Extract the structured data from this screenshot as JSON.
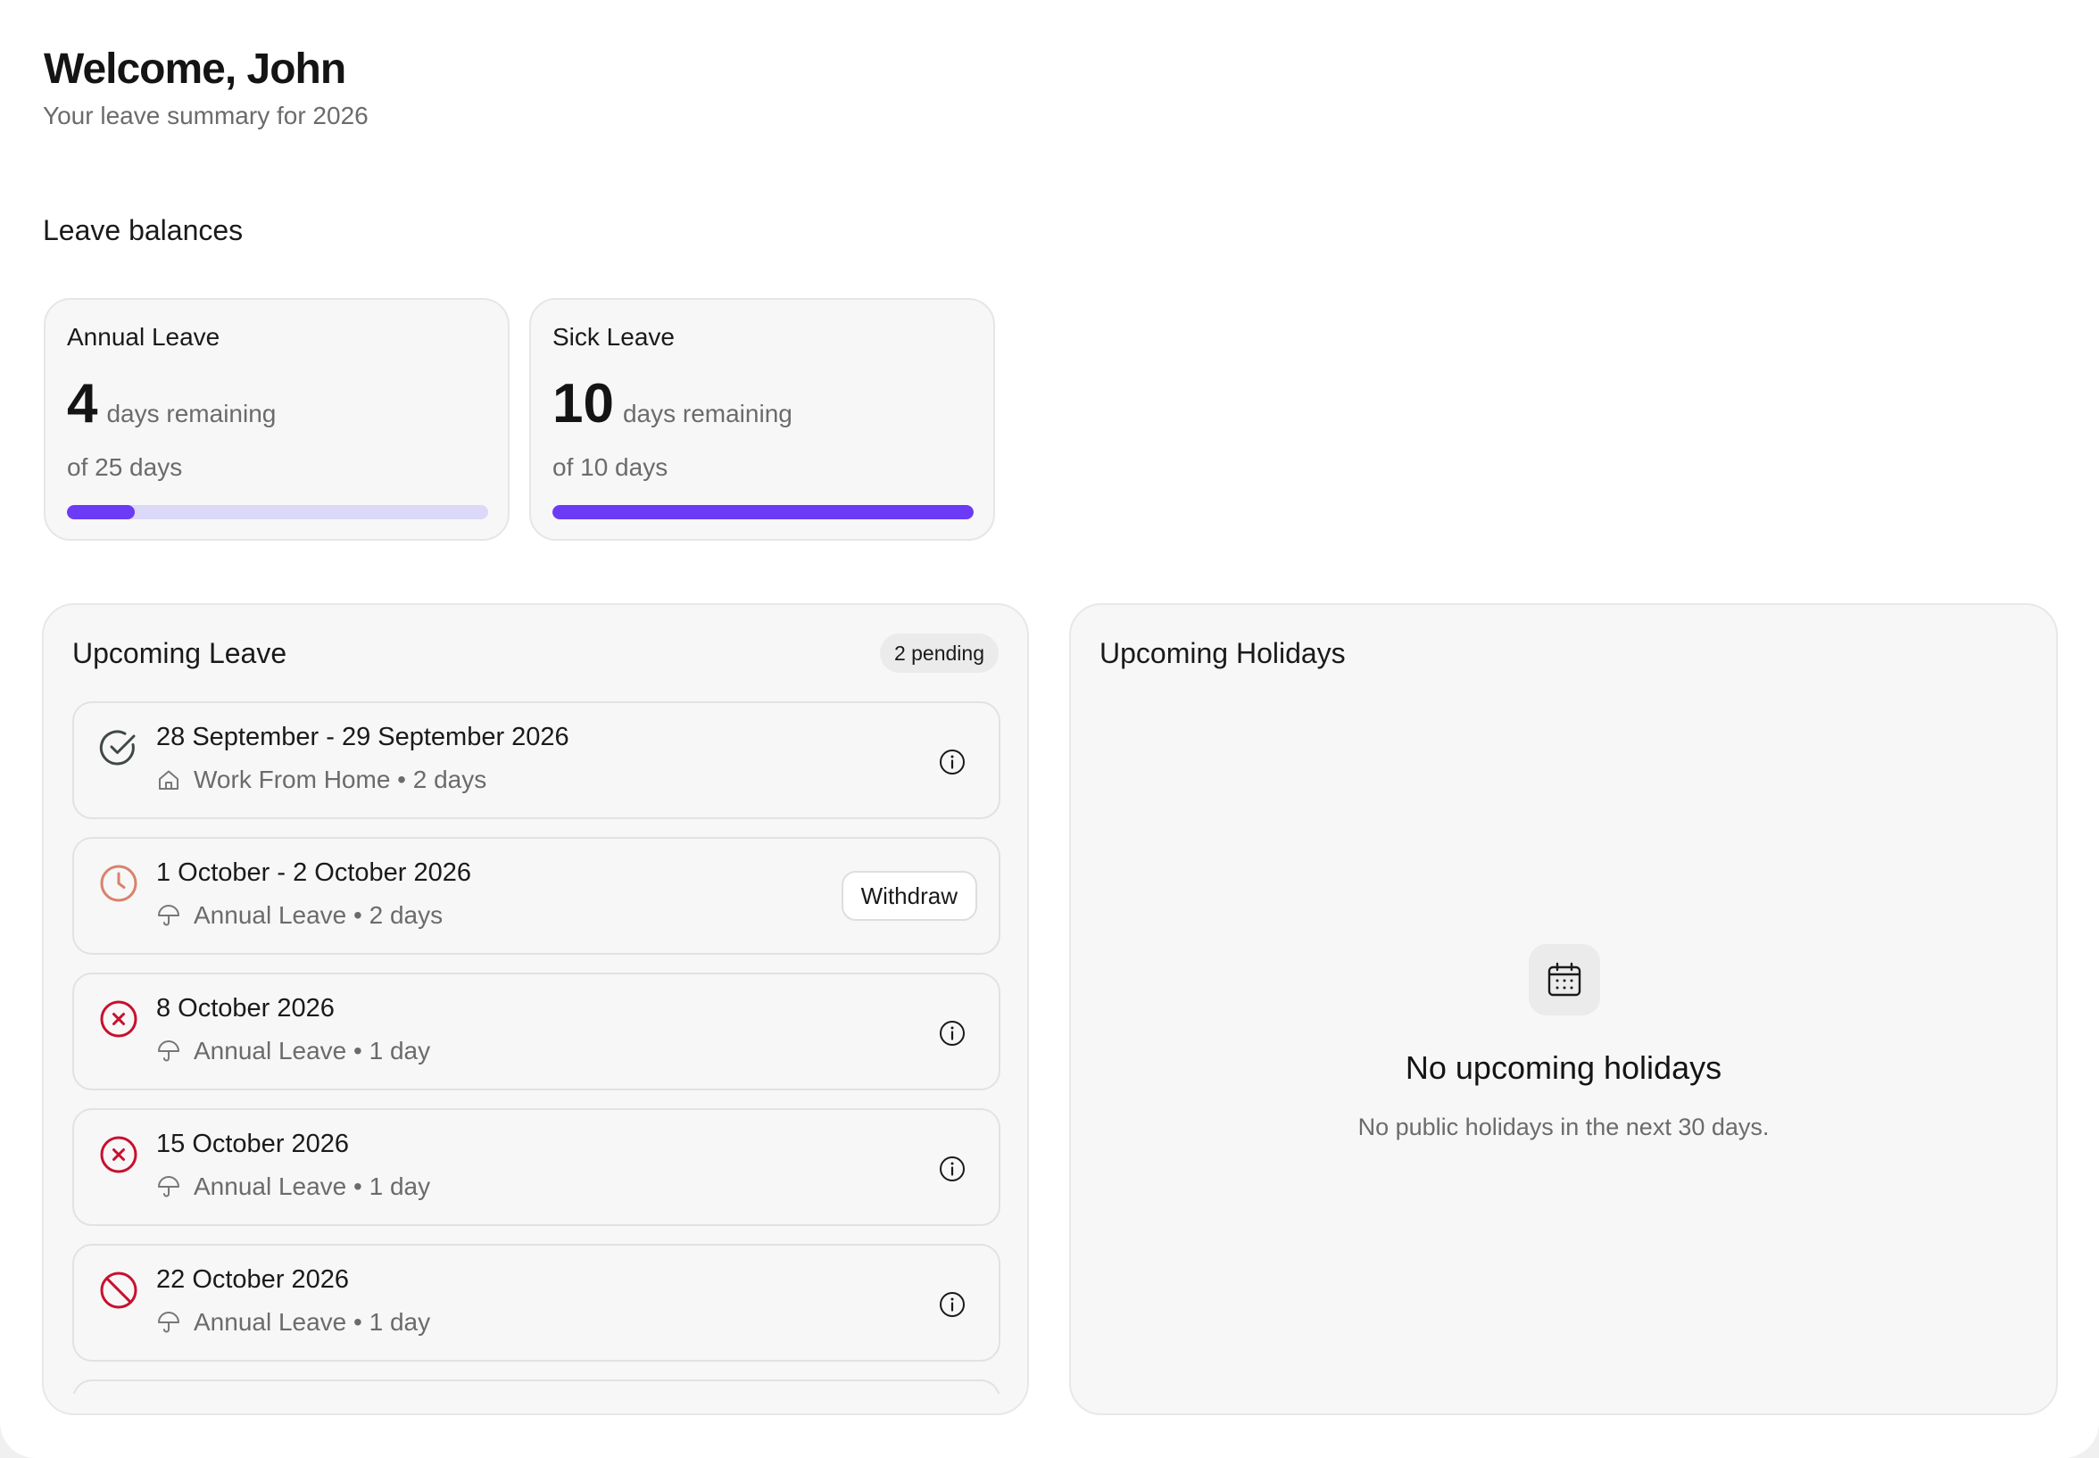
{
  "header": {
    "welcome": "Welcome, John",
    "subtitle": "Your leave summary for 2026"
  },
  "balances": {
    "section_title": "Leave balances",
    "cards": [
      {
        "title": "Annual Leave",
        "value": "4",
        "remaining_label": "days remaining",
        "total_label": "of 25 days",
        "remaining_fraction": 0.16
      },
      {
        "title": "Sick Leave",
        "value": "10",
        "remaining_label": "days remaining",
        "total_label": "of 10 days",
        "remaining_fraction": 1.0
      }
    ]
  },
  "upcoming_leave": {
    "title": "Upcoming Leave",
    "pending_badge": "2 pending",
    "items": [
      {
        "date": "28 September - 29 September 2026",
        "meta": "Work From Home • 2 days",
        "status_icon": "approved-check-icon",
        "type_icon": "home-icon",
        "action": "info"
      },
      {
        "date": "1 October - 2 October 2026",
        "meta": "Annual Leave • 2 days",
        "status_icon": "pending-clock-icon",
        "type_icon": "umbrella-icon",
        "action": "withdraw",
        "action_label": "Withdraw"
      },
      {
        "date": "8 October 2026",
        "meta": "Annual Leave • 1 day",
        "status_icon": "rejected-x-icon",
        "type_icon": "umbrella-icon",
        "action": "info"
      },
      {
        "date": "15 October 2026",
        "meta": "Annual Leave • 1 day",
        "status_icon": "rejected-x-icon",
        "type_icon": "umbrella-icon",
        "action": "info"
      },
      {
        "date": "22 October 2026",
        "meta": "Annual Leave • 1 day",
        "status_icon": "cancelled-ban-icon",
        "type_icon": "umbrella-icon",
        "action": "info"
      }
    ]
  },
  "upcoming_holidays": {
    "title": "Upcoming Holidays",
    "empty_icon": "calendar-icon",
    "empty_title": "No upcoming holidays",
    "empty_description": "No public holidays in the next 30 days."
  },
  "colors": {
    "accent": "#6c3bf5",
    "accent_track": "#dcd8f7",
    "approved": "#3f4a44",
    "pending": "#d9826b",
    "rejected": "#c8102e"
  }
}
